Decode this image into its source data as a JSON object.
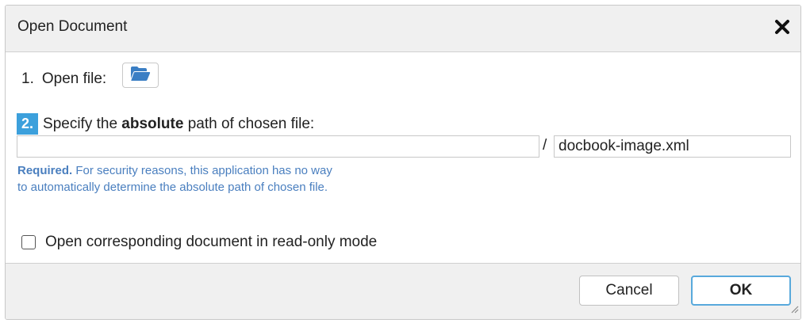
{
  "dialog": {
    "title": "Open Document"
  },
  "step1": {
    "number": "1.",
    "label": "Open file:",
    "icon": "folder-open-icon"
  },
  "step2": {
    "number": "2.",
    "text_before": "Specify the",
    "text_bold": "absolute",
    "text_after": "path of chosen file:",
    "directory_value": "",
    "separator": "/",
    "filename_value": "docbook-image.xml"
  },
  "hint": {
    "required": "Required.",
    "line1": "For security reasons, this application has no way",
    "line2": "to automatically determine the absolute path of chosen file."
  },
  "readonly_option": {
    "label": "Open corresponding document in read-only mode",
    "checked": false
  },
  "buttons": {
    "cancel": "Cancel",
    "ok": "OK"
  },
  "colors": {
    "accent": "#3ca0dc",
    "hint": "#4a7fbf",
    "ok_border": "#58a9dc"
  }
}
